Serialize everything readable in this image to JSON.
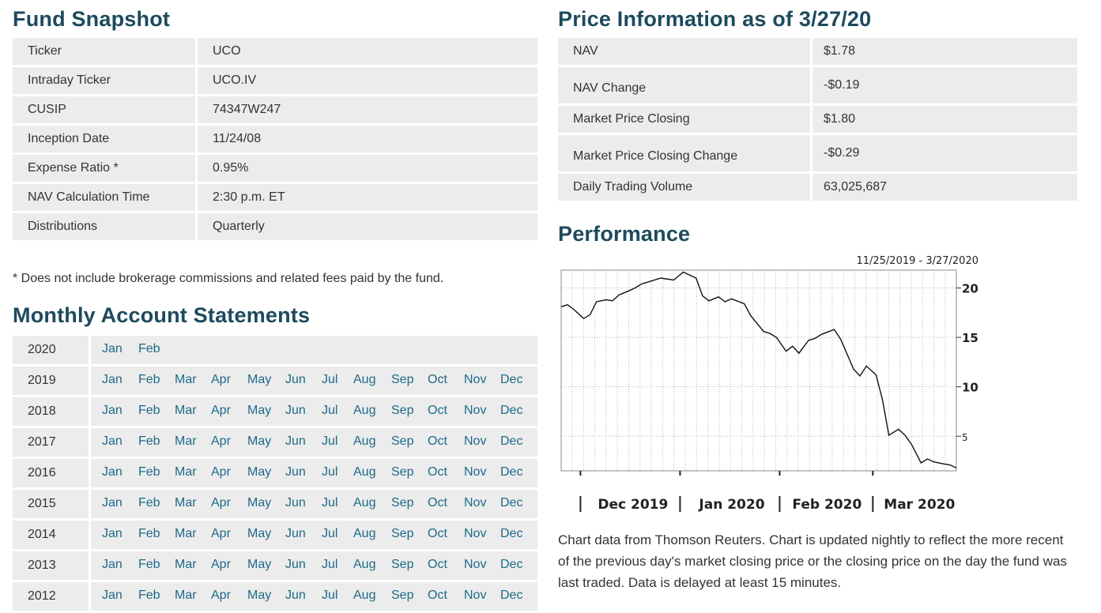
{
  "fund_snapshot": {
    "title": "Fund Snapshot",
    "rows": [
      {
        "label": "Ticker",
        "value": "UCO"
      },
      {
        "label": "Intraday Ticker",
        "value": "UCO.IV"
      },
      {
        "label": "CUSIP",
        "value": "74347W247"
      },
      {
        "label": "Inception Date",
        "value": "11/24/08"
      },
      {
        "label": "Expense Ratio *",
        "value": "0.95%"
      },
      {
        "label": "NAV Calculation Time",
        "value": "2:30 p.m. ET"
      },
      {
        "label": "Distributions",
        "value": "Quarterly"
      }
    ],
    "footnote": "* Does not include brokerage commissions and related fees paid by the fund."
  },
  "statements": {
    "title": "Monthly Account Statements",
    "rows": [
      {
        "year": "2020",
        "months": [
          "Jan",
          "Feb"
        ]
      },
      {
        "year": "2019",
        "months": [
          "Jan",
          "Feb",
          "Mar",
          "Apr",
          "May",
          "Jun",
          "Jul",
          "Aug",
          "Sep",
          "Oct",
          "Nov",
          "Dec"
        ]
      },
      {
        "year": "2018",
        "months": [
          "Jan",
          "Feb",
          "Mar",
          "Apr",
          "May",
          "Jun",
          "Jul",
          "Aug",
          "Sep",
          "Oct",
          "Nov",
          "Dec"
        ]
      },
      {
        "year": "2017",
        "months": [
          "Jan",
          "Feb",
          "Mar",
          "Apr",
          "May",
          "Jun",
          "Jul",
          "Aug",
          "Sep",
          "Oct",
          "Nov",
          "Dec"
        ]
      },
      {
        "year": "2016",
        "months": [
          "Jan",
          "Feb",
          "Mar",
          "Apr",
          "May",
          "Jun",
          "Jul",
          "Aug",
          "Sep",
          "Oct",
          "Nov",
          "Dec"
        ]
      },
      {
        "year": "2015",
        "months": [
          "Jan",
          "Feb",
          "Mar",
          "Apr",
          "May",
          "Jun",
          "Jul",
          "Aug",
          "Sep",
          "Oct",
          "Nov",
          "Dec"
        ]
      },
      {
        "year": "2014",
        "months": [
          "Jan",
          "Feb",
          "Mar",
          "Apr",
          "May",
          "Jun",
          "Jul",
          "Aug",
          "Sep",
          "Oct",
          "Nov",
          "Dec"
        ]
      },
      {
        "year": "2013",
        "months": [
          "Jan",
          "Feb",
          "Mar",
          "Apr",
          "May",
          "Jun",
          "Jul",
          "Aug",
          "Sep",
          "Oct",
          "Nov",
          "Dec"
        ]
      },
      {
        "year": "2012",
        "months": [
          "Jan",
          "Feb",
          "Mar",
          "Apr",
          "May",
          "Jun",
          "Jul",
          "Aug",
          "Sep",
          "Oct",
          "Nov",
          "Dec"
        ]
      }
    ]
  },
  "price_info": {
    "title": "Price Information as of 3/27/20",
    "rows": [
      {
        "label": "NAV",
        "value": "$1.78",
        "negative": false
      },
      {
        "label": "NAV Change",
        "value": "-$0.19",
        "negative": true
      },
      {
        "label": "Market Price Closing",
        "value": "$1.80",
        "negative": false
      },
      {
        "label": "Market Price Closing Change",
        "value": "-$0.29",
        "negative": true
      },
      {
        "label": "Daily Trading Volume",
        "value": "63,025,687",
        "negative": false
      }
    ]
  },
  "performance": {
    "title": "Performance",
    "note": "Chart data from Thomson Reuters. Chart is updated nightly to reflect the more recent of the previous day's market closing price or the closing price on the day the fund was last traded. Data is delayed at least 15 minutes."
  },
  "colors": {
    "heading": "#1d4a5e",
    "link": "#1d6a8a",
    "negative": "#c0171b",
    "row_bg": "#ececec"
  },
  "chart_data": {
    "type": "line",
    "title": "11/25/2019 - 3/27/2020",
    "xlabel": "",
    "ylabel": "",
    "x_labels": [
      "Dec 2019",
      "Jan 2020",
      "Feb 2020",
      "Mar 2020"
    ],
    "y_ticks": [
      5,
      10,
      15,
      20
    ],
    "ylim": [
      1.5,
      21.8
    ],
    "x_range": [
      "2019-11-25",
      "2020-03-27"
    ],
    "grid": true,
    "series": [
      {
        "x": [
          "2019-11-25",
          "2019-11-27",
          "2019-11-29",
          "2019-12-02",
          "2019-12-04",
          "2019-12-06",
          "2019-12-09",
          "2019-12-11",
          "2019-12-13",
          "2019-12-16",
          "2019-12-18",
          "2019-12-20",
          "2019-12-23",
          "2019-12-26",
          "2019-12-30",
          "2020-01-02",
          "2020-01-06",
          "2020-01-08",
          "2020-01-10",
          "2020-01-13",
          "2020-01-15",
          "2020-01-17",
          "2020-01-21",
          "2020-01-23",
          "2020-01-27",
          "2020-01-29",
          "2020-01-31",
          "2020-02-03",
          "2020-02-05",
          "2020-02-07",
          "2020-02-10",
          "2020-02-12",
          "2020-02-14",
          "2020-02-18",
          "2020-02-20",
          "2020-02-24",
          "2020-02-26",
          "2020-02-28",
          "2020-03-02",
          "2020-03-04",
          "2020-03-06",
          "2020-03-09",
          "2020-03-11",
          "2020-03-13",
          "2020-03-16",
          "2020-03-18",
          "2020-03-20",
          "2020-03-23",
          "2020-03-25",
          "2020-03-27"
        ],
        "values": [
          18.1,
          18.3,
          17.8,
          16.9,
          17.3,
          18.6,
          18.8,
          18.7,
          19.3,
          19.7,
          20.0,
          20.4,
          20.7,
          21.0,
          20.8,
          21.6,
          21.0,
          19.2,
          18.7,
          19.1,
          18.6,
          18.9,
          18.4,
          17.2,
          15.6,
          15.4,
          15.0,
          13.6,
          14.1,
          13.4,
          14.7,
          14.9,
          15.3,
          15.8,
          14.8,
          11.8,
          11.1,
          12.1,
          11.2,
          8.7,
          5.1,
          5.7,
          5.1,
          4.2,
          2.3,
          2.7,
          2.4,
          2.2,
          2.1,
          1.8
        ]
      }
    ]
  }
}
